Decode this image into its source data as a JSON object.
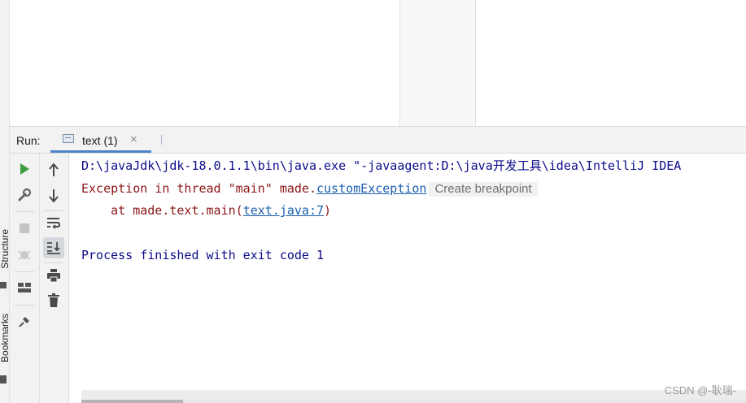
{
  "sidebar": {
    "structure_label": "Structure",
    "bookmarks_label": "Bookmarks"
  },
  "run_panel": {
    "title": "Run:",
    "tab": {
      "label": "text (1)",
      "close": "×"
    }
  },
  "console": {
    "cmd_line": "D:\\javaJdk\\jdk-18.0.1.1\\bin\\java.exe \"-javaagent:D:\\java开发工具\\idea\\IntelliJ IDEA",
    "exception_prefix": "Exception in thread \"main\" made.",
    "exception_link": "customException",
    "hint": "Create breakpoint",
    "trace_prefix": "    at made.text.main(",
    "trace_link": "text.java:7",
    "trace_suffix": ")",
    "process_line": "Process finished with exit code 1"
  },
  "watermark": "CSDN @-耿瑞-",
  "colors": {
    "command_text": "#0b0b8a",
    "error_text": "#8b1515",
    "link": "#1b5fae",
    "run_green": "#3e9b3e",
    "tab_underline": "#4a86c7"
  },
  "icons": {
    "toolbar1": [
      "run-icon",
      "wrench-icon",
      "stop-icon",
      "debug-icon",
      "layout-icon",
      "pin-icon"
    ],
    "toolbar2": [
      "arrow-up-icon",
      "arrow-down-icon",
      "soft-wrap-icon",
      "scroll-to-end-icon",
      "print-icon",
      "trash-icon"
    ]
  }
}
